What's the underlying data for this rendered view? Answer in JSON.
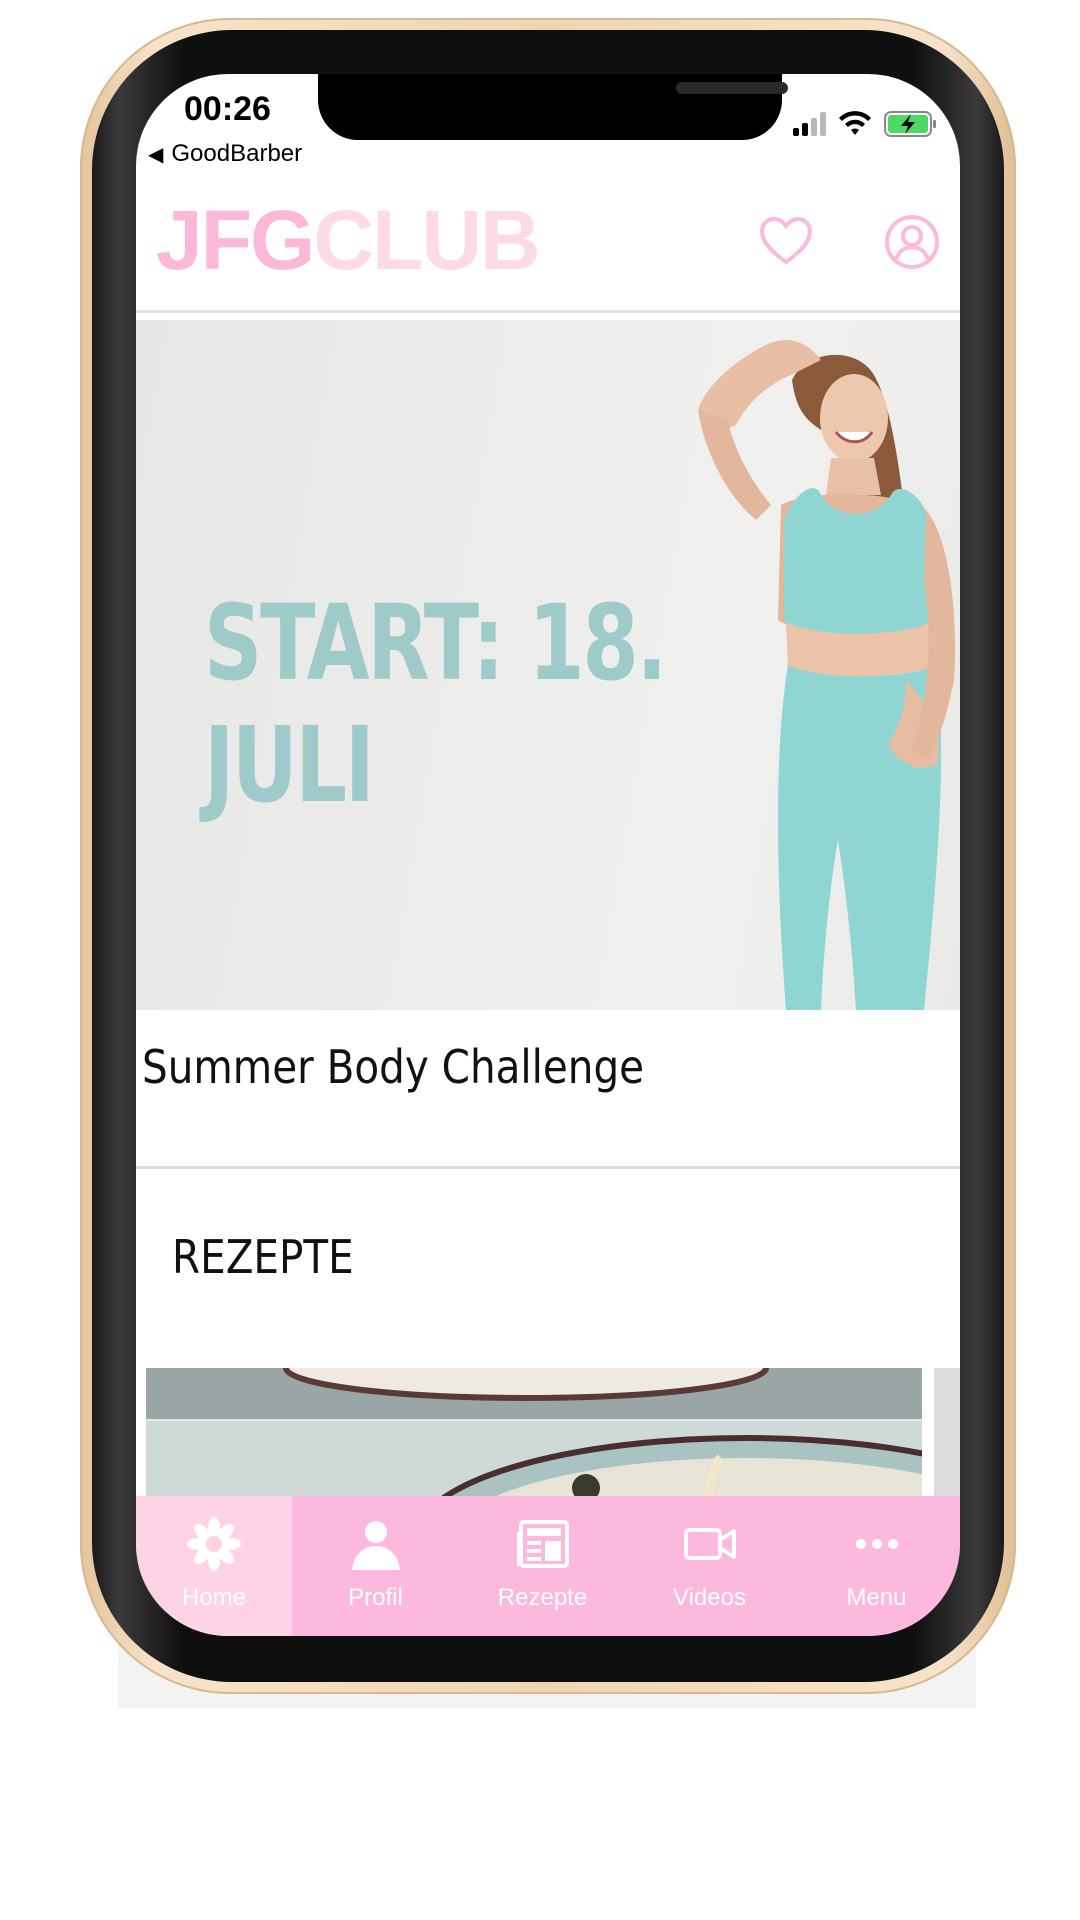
{
  "status_bar": {
    "time": "00:26",
    "back_app": "GoodBarber"
  },
  "header": {
    "logo_part1": "JFG",
    "logo_part2": "CLUB"
  },
  "hero": {
    "overlay_text": "START: 18. JULI"
  },
  "card": {
    "title": "Summer Body Challenge"
  },
  "section": {
    "title": "REZEPTE"
  },
  "tabbar": {
    "tabs": [
      {
        "label": "Home",
        "icon": "flower-icon"
      },
      {
        "label": "Profil",
        "icon": "person-icon"
      },
      {
        "label": "Rezepte",
        "icon": "newspaper-icon"
      },
      {
        "label": "Videos",
        "icon": "video-camera-icon"
      },
      {
        "label": "Menu",
        "icon": "more-dots-icon"
      }
    ]
  },
  "colors": {
    "brand_pink": "#fcb9dd",
    "logo_light": "#fcdbe4",
    "hero_text": "#9fcaca",
    "active_tab": "#fdd3e5"
  }
}
